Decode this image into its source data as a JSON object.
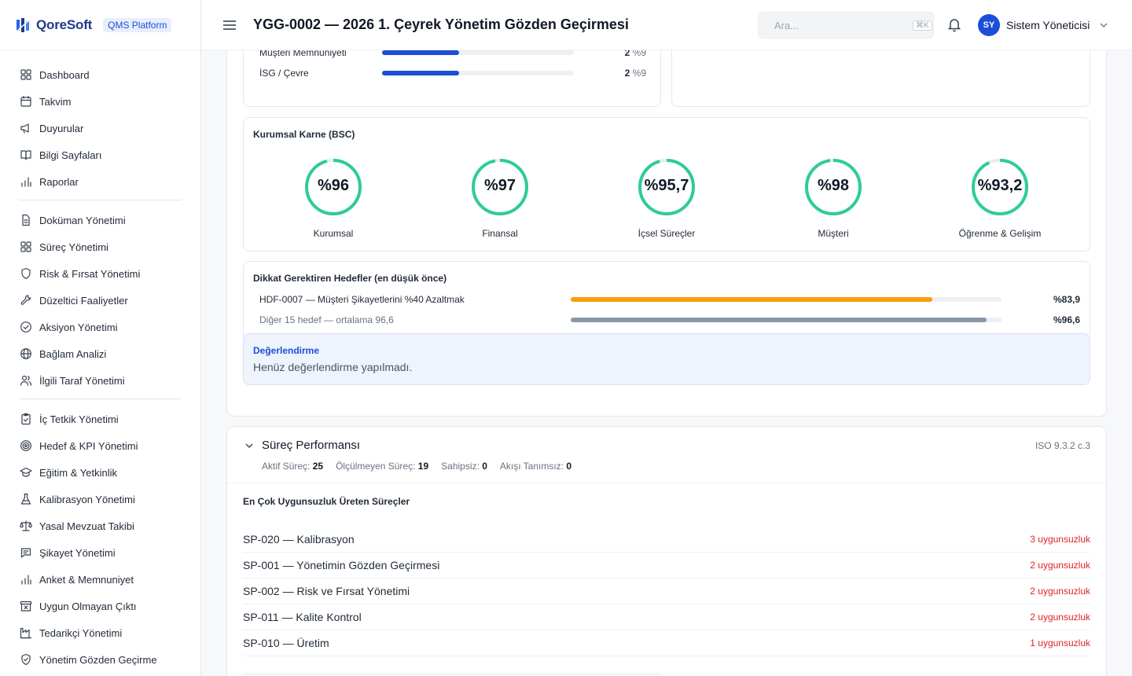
{
  "brand": {
    "name": "QoreSoft",
    "badge": "QMS Platform"
  },
  "header": {
    "title": "YGG-0002 — 2026 1. Çeyrek Yönetim Gözden Geçirmesi",
    "search_placeholder": "Ara...",
    "search_shortcut": "⌘K",
    "user_initials": "SY",
    "user_name": "Sistem Yöneticisi"
  },
  "sidebar": {
    "groups": [
      [
        {
          "label": "Dashboard",
          "icon": "grid-icon"
        },
        {
          "label": "Takvim",
          "icon": "calendar-icon"
        },
        {
          "label": "Duyurular",
          "icon": "megaphone-icon"
        },
        {
          "label": "Bilgi Sayfaları",
          "icon": "book-icon"
        },
        {
          "label": "Raporlar",
          "icon": "bar-chart-icon"
        }
      ],
      [
        {
          "label": "Doküman Yönetimi",
          "icon": "document-icon"
        },
        {
          "label": "Süreç Yönetimi",
          "icon": "grid-icon"
        },
        {
          "label": "Risk & Fırsat Yönetimi",
          "icon": "shield-icon"
        },
        {
          "label": "Düzeltici Faaliyetler",
          "icon": "wrench-icon"
        },
        {
          "label": "Aksiyon Yönetimi",
          "icon": "check-circle-icon"
        },
        {
          "label": "Bağlam Analizi",
          "icon": "globe-icon"
        },
        {
          "label": "İlgili Taraf Yönetimi",
          "icon": "users-icon"
        }
      ],
      [
        {
          "label": "İç Tetkik Yönetimi",
          "icon": "clipboard-check-icon"
        },
        {
          "label": "Hedef & KPI Yönetimi",
          "icon": "target-icon"
        },
        {
          "label": "Eğitim & Yetkinlik",
          "icon": "graduation-cap-icon"
        },
        {
          "label": "Kalibrasyon Yönetimi",
          "icon": "flask-icon"
        },
        {
          "label": "Yasal Mevzuat Takibi",
          "icon": "scale-icon"
        },
        {
          "label": "Şikayet Yönetimi",
          "icon": "message-icon"
        },
        {
          "label": "Anket & Memnuniyet",
          "icon": "bar-chart-icon"
        },
        {
          "label": "Uygun Olmayan Çıktı",
          "icon": "archive-x-icon"
        },
        {
          "label": "Tedarikçi Yönetimi",
          "icon": "factory-icon"
        },
        {
          "label": "Yönetim Gözden Geçirme",
          "icon": "shield-check-icon"
        }
      ]
    ]
  },
  "topics": [
    {
      "label": "Müşteri Memnuniyeti",
      "count": "2",
      "pct_text": "%9",
      "pct": 0.4
    },
    {
      "label": "İSG / Çevre",
      "count": "2",
      "pct_text": "%9",
      "pct": 0.4
    }
  ],
  "bsc": {
    "title": "Kurumsal Karne (BSC)",
    "items": [
      {
        "label": "Kurumsal",
        "value_text": "%96",
        "value": 96
      },
      {
        "label": "Finansal",
        "value_text": "%97",
        "value": 97
      },
      {
        "label": "İçsel Süreçler",
        "value_text": "%95,7",
        "value": 95.7
      },
      {
        "label": "Müşteri",
        "value_text": "%98",
        "value": 98
      },
      {
        "label": "Öğrenme & Gelişim",
        "value_text": "%93,2",
        "value": 93.2
      }
    ],
    "color": "#2ecc9a"
  },
  "goals": {
    "title": "Dikkat Gerektiren Hedefler (en düşük önce)",
    "rows": [
      {
        "label": "HDF-0007 — Müşteri Şikayetlerini %40 Azaltmak",
        "value_text": "%83,9",
        "value": 83.9,
        "color": "#f59e0b"
      },
      {
        "label": "Diğer 15 hedef — ortalama 96,6",
        "value_text": "%96,6",
        "value": 96.6,
        "color": "#8a96aa"
      }
    ]
  },
  "evaluation": {
    "title": "Değerlendirme",
    "text": "Henüz değerlendirme yapılmadı."
  },
  "process": {
    "title": "Süreç Performansı",
    "iso": "ISO 9.3.2 c.3",
    "stats": [
      {
        "label": "Aktif Süreç:",
        "value": "25"
      },
      {
        "label": "Ölçülmeyen Süreç:",
        "value": "19"
      },
      {
        "label": "Sahipsiz:",
        "value": "0"
      },
      {
        "label": "Akışı Tanımsız:",
        "value": "0"
      }
    ],
    "subtitle": "En Çok Uygunsuzluk Üreten Süreçler",
    "rows": [
      {
        "name": "SP-020 — Kalibrasyon",
        "count": "3 uygunsuzluk"
      },
      {
        "name": "SP-001 — Yönetimin Gözden Geçirmesi",
        "count": "2 uygunsuzluk"
      },
      {
        "name": "SP-002 — Risk ve Fırsat Yönetimi",
        "count": "2 uygunsuzluk"
      },
      {
        "name": "SP-011 — Kalite Kontrol",
        "count": "2 uygunsuzluk"
      },
      {
        "name": "SP-010 — Üretim",
        "count": "1 uygunsuzluk"
      }
    ]
  }
}
